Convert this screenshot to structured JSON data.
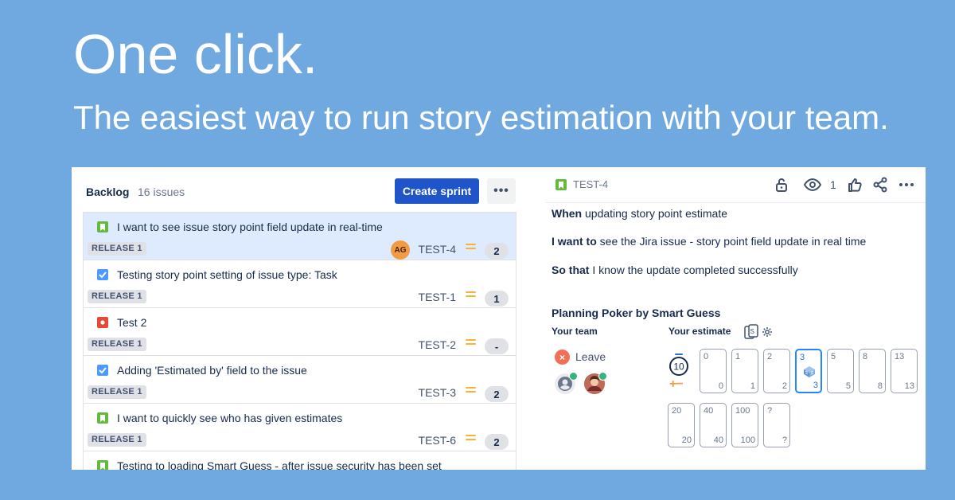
{
  "headline": "One click.",
  "subheadline": "The easiest way to run story estimation with your team.",
  "colors": {
    "background": "#70a8e0",
    "primary_button": "#1f55c9",
    "selected_row": "#deebff",
    "story_icon": "#63ba3c",
    "task_icon": "#4c9aff",
    "bug_icon": "#e5493a",
    "priority_medium": "#f7b23a",
    "selected_card": "#2684ff"
  },
  "backlog": {
    "title": "Backlog",
    "count": "16 issues",
    "create_sprint_label": "Create sprint",
    "more_label": "•••",
    "issues": [
      {
        "type": "story-icon",
        "summary": "I want to see issue story point field update in real-time",
        "release": "RELEASE 1",
        "assignee": "AG",
        "key": "TEST-4",
        "points": "2",
        "selected": true
      },
      {
        "type": "task-icon",
        "summary": "Testing story point setting of issue type: Task",
        "release": "RELEASE 1",
        "key": "TEST-1",
        "points": "1"
      },
      {
        "type": "bug-icon",
        "summary": "Test 2",
        "release": "RELEASE 1",
        "key": "TEST-2",
        "points": "-"
      },
      {
        "type": "task-icon",
        "summary": "Adding 'Estimated by' field to the issue",
        "release": "RELEASE 1",
        "key": "TEST-3",
        "points": "2"
      },
      {
        "type": "story-icon",
        "summary": "I want to quickly see who has given estimates",
        "release": "RELEASE 1",
        "key": "TEST-6",
        "points": "2"
      },
      {
        "type": "story-icon",
        "summary": "Testing to loading Smart Guess - after issue security has been set"
      }
    ]
  },
  "detail": {
    "key": "TEST-4",
    "watch_count": "1",
    "toolbar_icons": [
      "lock-icon",
      "eye-icon",
      "thumbs-up-icon",
      "share-icon",
      "more-icon"
    ],
    "story": [
      {
        "bold": "When",
        "rest": " updating story point estimate"
      },
      {
        "bold": "I want to",
        "rest": " see the Jira issue - story point field update in real time"
      },
      {
        "bold": "So that",
        "rest": " I know the update completed successfully"
      }
    ],
    "poker": {
      "title": "Planning Poker by Smart Guess",
      "your_team_label": "Your team",
      "your_estimate_label": "Your estimate",
      "leave_label": "Leave",
      "timer_value": "10",
      "adjust_label": "+−",
      "cards": [
        {
          "value": "0"
        },
        {
          "value": "1"
        },
        {
          "value": "2"
        },
        {
          "value": "3",
          "selected": true
        },
        {
          "value": "5"
        },
        {
          "value": "8"
        },
        {
          "value": "13"
        },
        {
          "value": "20"
        },
        {
          "value": "40"
        },
        {
          "value": "100"
        },
        {
          "value": "?"
        }
      ]
    }
  }
}
